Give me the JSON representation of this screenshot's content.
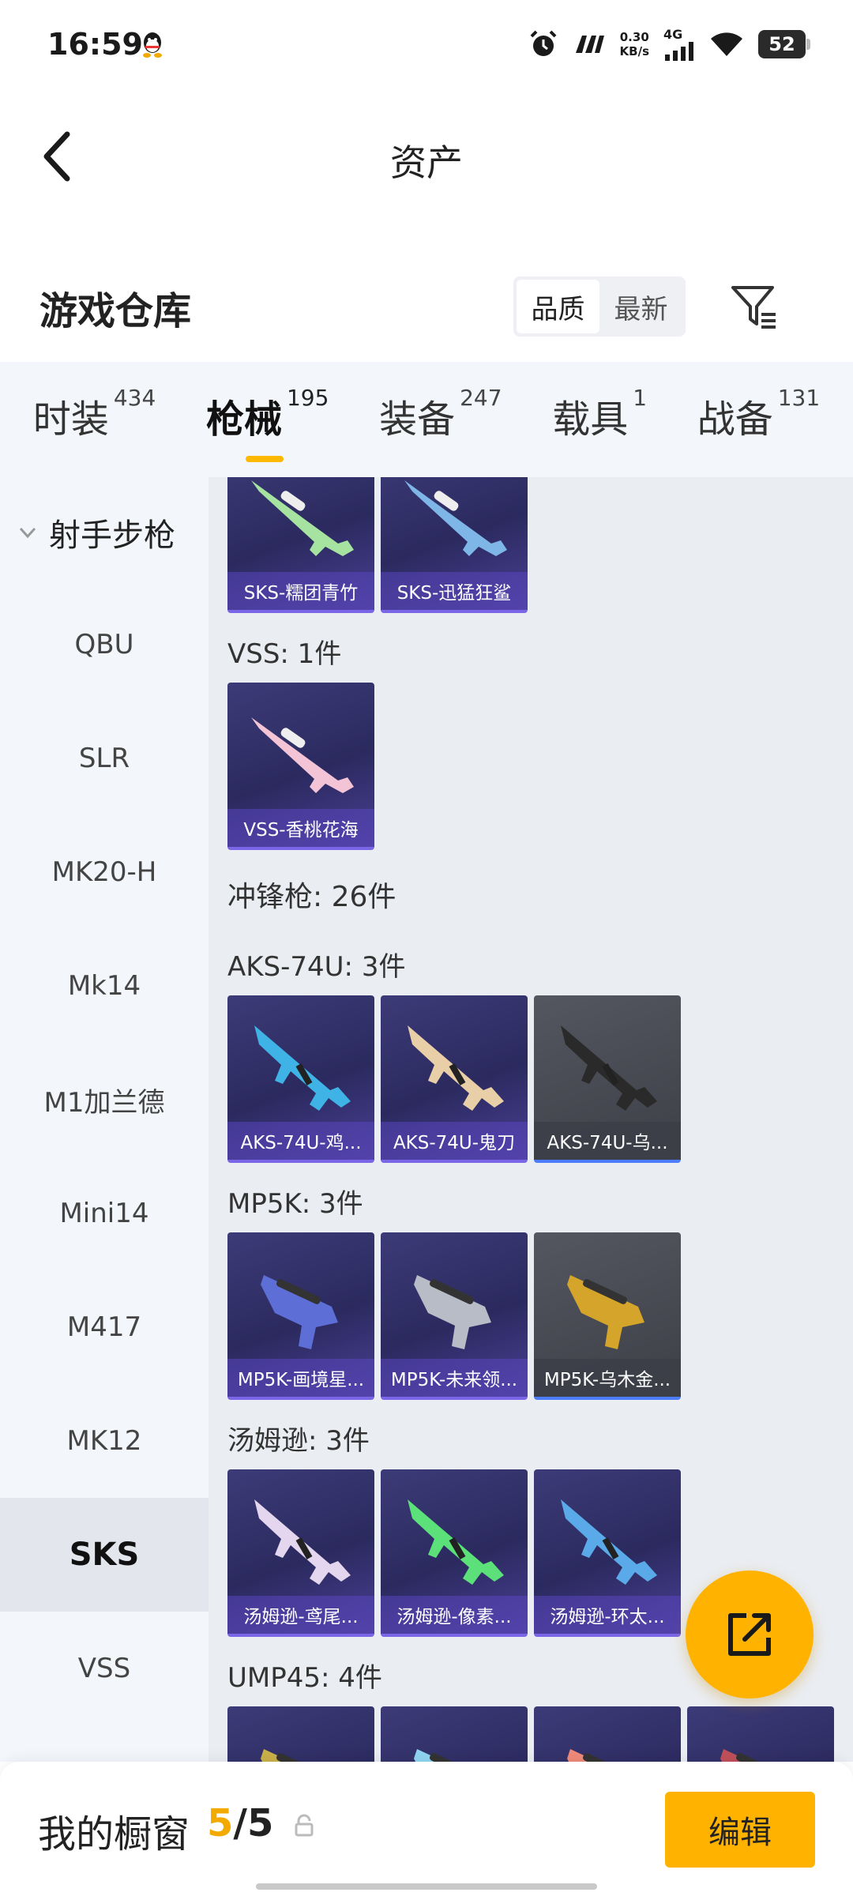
{
  "status_bar": {
    "time": "16:59",
    "network_speed_value": "0.30",
    "network_speed_unit": "KB/s",
    "network_type": "4G",
    "battery": "52",
    "icons": [
      "qq-icon",
      "alarm-icon",
      "app-icon",
      "signal-icon",
      "wifi-icon",
      "battery-icon"
    ]
  },
  "header": {
    "title": "资产"
  },
  "warehouse": {
    "title": "游戏仓库",
    "sort_options": [
      "品质",
      "最新"
    ],
    "active_sort": "品质"
  },
  "tabs": [
    {
      "label": "时装",
      "count": "434"
    },
    {
      "label": "枪械",
      "count": "195",
      "active": true
    },
    {
      "label": "装备",
      "count": "247"
    },
    {
      "label": "载具",
      "count": "1"
    },
    {
      "label": "战备",
      "count": "131"
    }
  ],
  "sidebar": {
    "group_label": "射手步枪",
    "items": [
      "QBU",
      "SLR",
      "MK20-H",
      "Mk14",
      "M1加兰德",
      "Mini14",
      "M417",
      "MK12",
      "SKS",
      "VSS"
    ],
    "active_item": "SKS"
  },
  "content": {
    "sks_row": [
      {
        "name": "SKS-糯团青竹",
        "gun_color": "#a7e3a0"
      },
      {
        "name": "SKS-迅猛狂鲨",
        "gun_color": "#7fb6e8"
      }
    ],
    "vss_label": "VSS: 1件",
    "vss_items": [
      {
        "name": "VSS-香桃花海",
        "gun_color": "#f3c4d6"
      }
    ],
    "smg_category": "冲锋枪: 26件",
    "aks_label": "AKS-74U: 3件",
    "aks_items": [
      {
        "name": "AKS-74U-鸡...",
        "gun_color": "#3fb3e6"
      },
      {
        "name": "AKS-74U-鬼刀",
        "gun_color": "#e8cfa8"
      },
      {
        "name": "AKS-74U-乌...",
        "gun_color": "#2a2a2a"
      }
    ],
    "mp5k_label": "MP5K: 3件",
    "mp5k_items": [
      {
        "name": "MP5K-画境星...",
        "gun_color": "#5d6fd6"
      },
      {
        "name": "MP5K-未来领...",
        "gun_color": "#b8bcc6"
      },
      {
        "name": "MP5K-乌木金...",
        "gun_color": "#d4a52a"
      }
    ],
    "tommy_label": "汤姆逊: 3件",
    "tommy_items": [
      {
        "name": "汤姆逊-鸢尾...",
        "gun_color": "#e3d6ee"
      },
      {
        "name": "汤姆逊-像素...",
        "gun_color": "#5be07a"
      },
      {
        "name": "汤姆逊-环太...",
        "gun_color": "#5aa9e8"
      }
    ],
    "ump_label": "UMP45: 4件",
    "ump_items": [
      {
        "gun_color": "#c9b04a"
      },
      {
        "gun_color": "#8fd4f2"
      },
      {
        "gun_color": "#f08a7a"
      },
      {
        "gun_color": "#c0505a"
      }
    ]
  },
  "bottom_bar": {
    "showcase_label": "我的橱窗",
    "showcase_current": "5",
    "showcase_separator": "/",
    "showcase_total": "5",
    "edit_label": "编辑"
  },
  "colors": {
    "accent": "#ffb300",
    "sidebar_bg": "#f3f7fb",
    "content_bg": "#eaedf2",
    "card_purple": "#3c3b78"
  }
}
